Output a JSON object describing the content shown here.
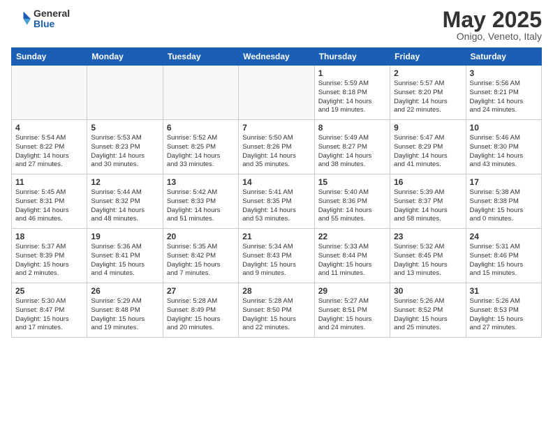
{
  "logo": {
    "general": "General",
    "blue": "Blue"
  },
  "title": "May 2025",
  "location": "Onigo, Veneto, Italy",
  "headers": [
    "Sunday",
    "Monday",
    "Tuesday",
    "Wednesday",
    "Thursday",
    "Friday",
    "Saturday"
  ],
  "weeks": [
    [
      {
        "day": "",
        "info": ""
      },
      {
        "day": "",
        "info": ""
      },
      {
        "day": "",
        "info": ""
      },
      {
        "day": "",
        "info": ""
      },
      {
        "day": "1",
        "info": "Sunrise: 5:59 AM\nSunset: 8:18 PM\nDaylight: 14 hours\nand 19 minutes."
      },
      {
        "day": "2",
        "info": "Sunrise: 5:57 AM\nSunset: 8:20 PM\nDaylight: 14 hours\nand 22 minutes."
      },
      {
        "day": "3",
        "info": "Sunrise: 5:56 AM\nSunset: 8:21 PM\nDaylight: 14 hours\nand 24 minutes."
      }
    ],
    [
      {
        "day": "4",
        "info": "Sunrise: 5:54 AM\nSunset: 8:22 PM\nDaylight: 14 hours\nand 27 minutes."
      },
      {
        "day": "5",
        "info": "Sunrise: 5:53 AM\nSunset: 8:23 PM\nDaylight: 14 hours\nand 30 minutes."
      },
      {
        "day": "6",
        "info": "Sunrise: 5:52 AM\nSunset: 8:25 PM\nDaylight: 14 hours\nand 33 minutes."
      },
      {
        "day": "7",
        "info": "Sunrise: 5:50 AM\nSunset: 8:26 PM\nDaylight: 14 hours\nand 35 minutes."
      },
      {
        "day": "8",
        "info": "Sunrise: 5:49 AM\nSunset: 8:27 PM\nDaylight: 14 hours\nand 38 minutes."
      },
      {
        "day": "9",
        "info": "Sunrise: 5:47 AM\nSunset: 8:29 PM\nDaylight: 14 hours\nand 41 minutes."
      },
      {
        "day": "10",
        "info": "Sunrise: 5:46 AM\nSunset: 8:30 PM\nDaylight: 14 hours\nand 43 minutes."
      }
    ],
    [
      {
        "day": "11",
        "info": "Sunrise: 5:45 AM\nSunset: 8:31 PM\nDaylight: 14 hours\nand 46 minutes."
      },
      {
        "day": "12",
        "info": "Sunrise: 5:44 AM\nSunset: 8:32 PM\nDaylight: 14 hours\nand 48 minutes."
      },
      {
        "day": "13",
        "info": "Sunrise: 5:42 AM\nSunset: 8:33 PM\nDaylight: 14 hours\nand 51 minutes."
      },
      {
        "day": "14",
        "info": "Sunrise: 5:41 AM\nSunset: 8:35 PM\nDaylight: 14 hours\nand 53 minutes."
      },
      {
        "day": "15",
        "info": "Sunrise: 5:40 AM\nSunset: 8:36 PM\nDaylight: 14 hours\nand 55 minutes."
      },
      {
        "day": "16",
        "info": "Sunrise: 5:39 AM\nSunset: 8:37 PM\nDaylight: 14 hours\nand 58 minutes."
      },
      {
        "day": "17",
        "info": "Sunrise: 5:38 AM\nSunset: 8:38 PM\nDaylight: 15 hours\nand 0 minutes."
      }
    ],
    [
      {
        "day": "18",
        "info": "Sunrise: 5:37 AM\nSunset: 8:39 PM\nDaylight: 15 hours\nand 2 minutes."
      },
      {
        "day": "19",
        "info": "Sunrise: 5:36 AM\nSunset: 8:41 PM\nDaylight: 15 hours\nand 4 minutes."
      },
      {
        "day": "20",
        "info": "Sunrise: 5:35 AM\nSunset: 8:42 PM\nDaylight: 15 hours\nand 7 minutes."
      },
      {
        "day": "21",
        "info": "Sunrise: 5:34 AM\nSunset: 8:43 PM\nDaylight: 15 hours\nand 9 minutes."
      },
      {
        "day": "22",
        "info": "Sunrise: 5:33 AM\nSunset: 8:44 PM\nDaylight: 15 hours\nand 11 minutes."
      },
      {
        "day": "23",
        "info": "Sunrise: 5:32 AM\nSunset: 8:45 PM\nDaylight: 15 hours\nand 13 minutes."
      },
      {
        "day": "24",
        "info": "Sunrise: 5:31 AM\nSunset: 8:46 PM\nDaylight: 15 hours\nand 15 minutes."
      }
    ],
    [
      {
        "day": "25",
        "info": "Sunrise: 5:30 AM\nSunset: 8:47 PM\nDaylight: 15 hours\nand 17 minutes."
      },
      {
        "day": "26",
        "info": "Sunrise: 5:29 AM\nSunset: 8:48 PM\nDaylight: 15 hours\nand 19 minutes."
      },
      {
        "day": "27",
        "info": "Sunrise: 5:28 AM\nSunset: 8:49 PM\nDaylight: 15 hours\nand 20 minutes."
      },
      {
        "day": "28",
        "info": "Sunrise: 5:28 AM\nSunset: 8:50 PM\nDaylight: 15 hours\nand 22 minutes."
      },
      {
        "day": "29",
        "info": "Sunrise: 5:27 AM\nSunset: 8:51 PM\nDaylight: 15 hours\nand 24 minutes."
      },
      {
        "day": "30",
        "info": "Sunrise: 5:26 AM\nSunset: 8:52 PM\nDaylight: 15 hours\nand 25 minutes."
      },
      {
        "day": "31",
        "info": "Sunrise: 5:26 AM\nSunset: 8:53 PM\nDaylight: 15 hours\nand 27 minutes."
      }
    ]
  ]
}
